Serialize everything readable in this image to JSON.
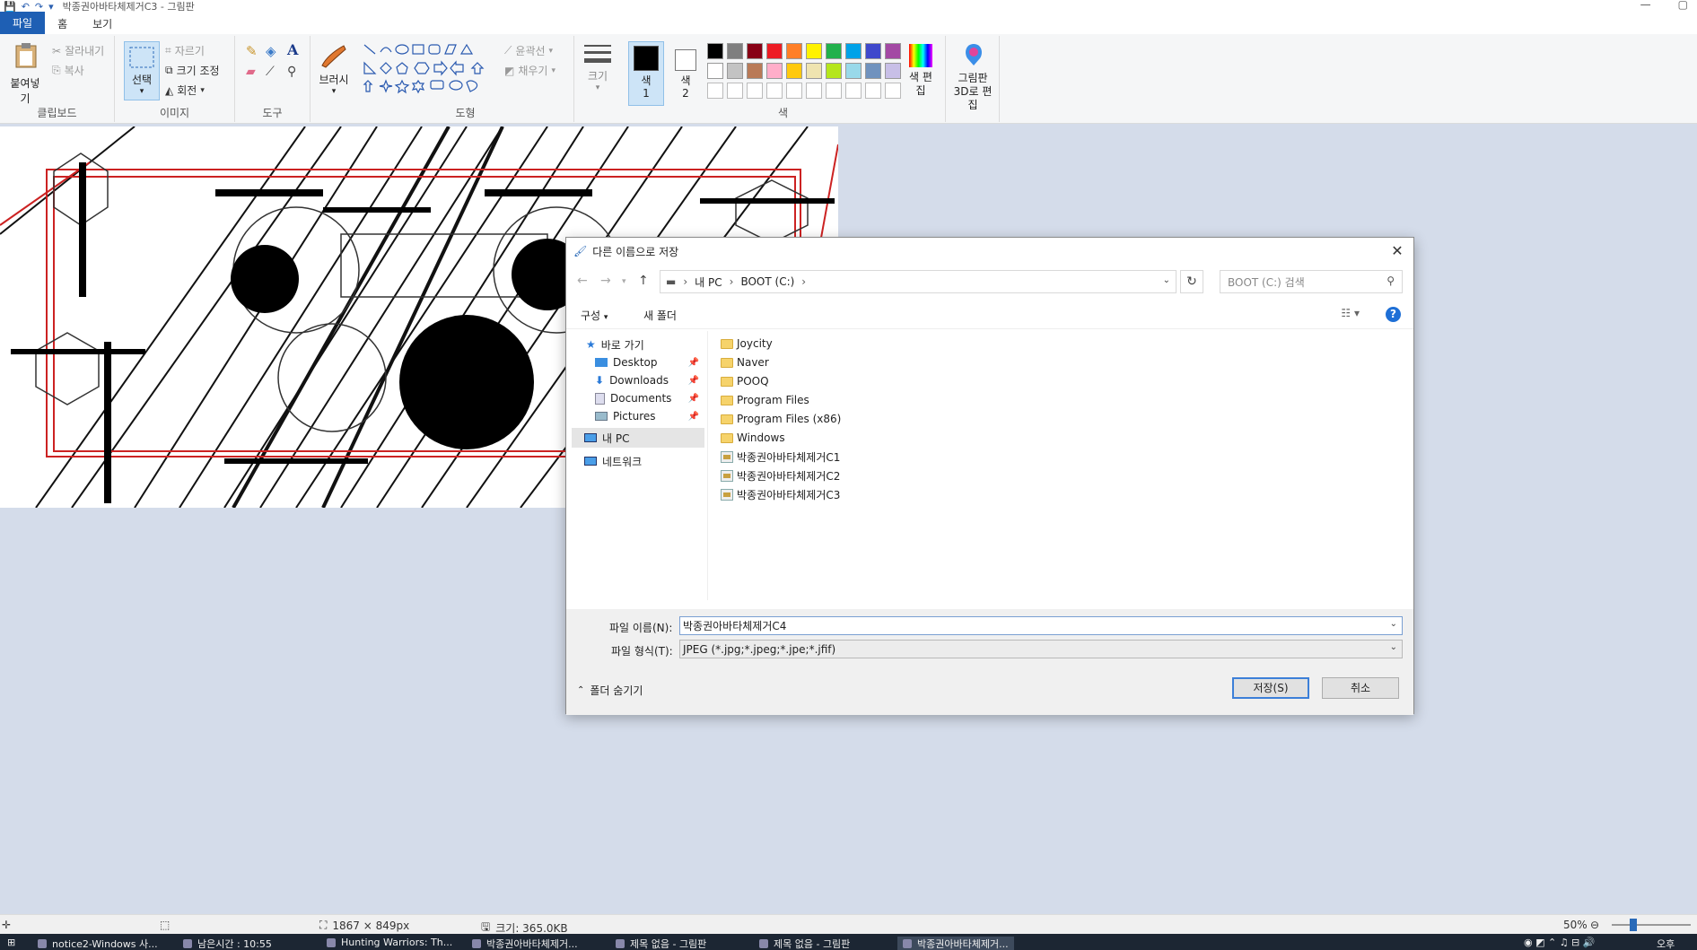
{
  "window": {
    "title": "박종권아바타체제거C3 - 그림판"
  },
  "ribbon": {
    "tabs": [
      "파일",
      "홈",
      "보기"
    ],
    "clipboard": {
      "paste": "붙여넣기",
      "cut": "잘라내기",
      "copy": "복사",
      "label": "클립보드"
    },
    "image": {
      "select": "선택",
      "crop": "자르기",
      "resize": "크기 조정",
      "rotate": "회전",
      "label": "이미지"
    },
    "tools": {
      "label": "도구"
    },
    "brush": {
      "label": "브러시"
    },
    "shapes": {
      "outline": "윤곽선",
      "fill": "채우기",
      "label": "도형"
    },
    "size": {
      "label": "크기"
    },
    "colors": {
      "color1": "색 1",
      "color2": "색 2",
      "edit": "색 편집",
      "label": "색",
      "palette_row1": [
        "#000000",
        "#7f7f7f",
        "#880015",
        "#ed1c24",
        "#ff7f27",
        "#fff200",
        "#22b14c",
        "#00a2e8",
        "#3f48cc",
        "#a349a4"
      ],
      "palette_row2": [
        "#ffffff",
        "#c3c3c3",
        "#b97a57",
        "#ffaec9",
        "#ffc90e",
        "#efe4b0",
        "#b5e61d",
        "#99d9ea",
        "#7092be",
        "#c8bfe7"
      ]
    },
    "paint3d": "그림판 3D로 편집"
  },
  "dialog": {
    "title": "다른 이름으로 저장",
    "breadcrumb": [
      "내 PC",
      "BOOT (C:)"
    ],
    "search_placeholder": "BOOT (C:) 검색",
    "organize": "구성",
    "new_folder": "새 폴더",
    "nav": {
      "quick_access": "바로 가기",
      "desktop": "Desktop",
      "downloads": "Downloads",
      "documents": "Documents",
      "pictures": "Pictures",
      "this_pc": "내 PC",
      "network": "네트워크"
    },
    "files": [
      {
        "name": "Joycity",
        "type": "folder"
      },
      {
        "name": "Naver",
        "type": "folder"
      },
      {
        "name": "POOQ",
        "type": "folder"
      },
      {
        "name": "Program Files",
        "type": "folder"
      },
      {
        "name": "Program Files (x86)",
        "type": "folder"
      },
      {
        "name": "Windows",
        "type": "folder"
      },
      {
        "name": "박종권아바타체제거C1",
        "type": "jpg"
      },
      {
        "name": "박종권아바타체제거C2",
        "type": "jpg"
      },
      {
        "name": "박종권아바타체제거C3",
        "type": "jpg"
      }
    ],
    "filename_label": "파일 이름(N):",
    "filename_value": "박종권아바타체제거C4",
    "filetype_label": "파일 형식(T):",
    "filetype_value": "JPEG (*.jpg;*.jpeg;*.jpe;*.jfif)",
    "hide_folders": "폴더 숨기기",
    "save": "저장(S)",
    "cancel": "취소"
  },
  "statusbar": {
    "dimensions": "1867 × 849px",
    "size": "크기: 365.0KB",
    "zoom": "50%"
  },
  "taskbar": [
    "notice2-Windows 사...",
    "남은시간 : 10:55",
    "Hunting Warriors: Th...",
    "박종권아바타체제거...",
    "제목 없음 - 그림판",
    "제목 없음 - 그림판",
    "박종권아바타체제거..."
  ],
  "clock": "오후"
}
